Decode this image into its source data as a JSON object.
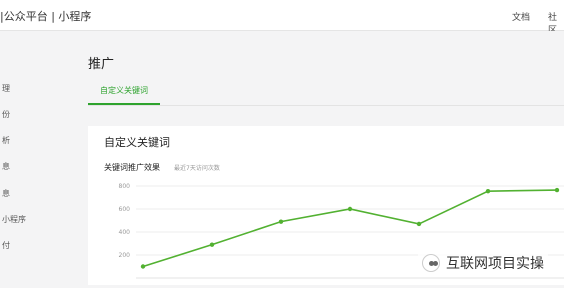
{
  "header": {
    "brand": "|公众平台 | 小程序",
    "links": [
      "文档",
      "社区"
    ]
  },
  "sidebar": {
    "items": [
      "理",
      "份",
      "析",
      "息",
      "息",
      "小程序",
      "付"
    ]
  },
  "main": {
    "page_title": "推广",
    "tab_label": "自定义关键词",
    "card_title": "自定义关键词",
    "chart_title": "关键词推广效果",
    "chart_subtitle": "最近7天访问次数"
  },
  "watermark": "互联网项目实操",
  "chart_data": {
    "type": "line",
    "x": [
      "",
      "",
      "",
      "",
      "",
      "",
      ""
    ],
    "y": [
      100,
      290,
      490,
      600,
      470,
      755,
      765
    ],
    "ylim": [
      0,
      800
    ],
    "yticks": [
      200,
      400,
      600,
      800
    ],
    "grid": true,
    "color": "#52b131"
  }
}
